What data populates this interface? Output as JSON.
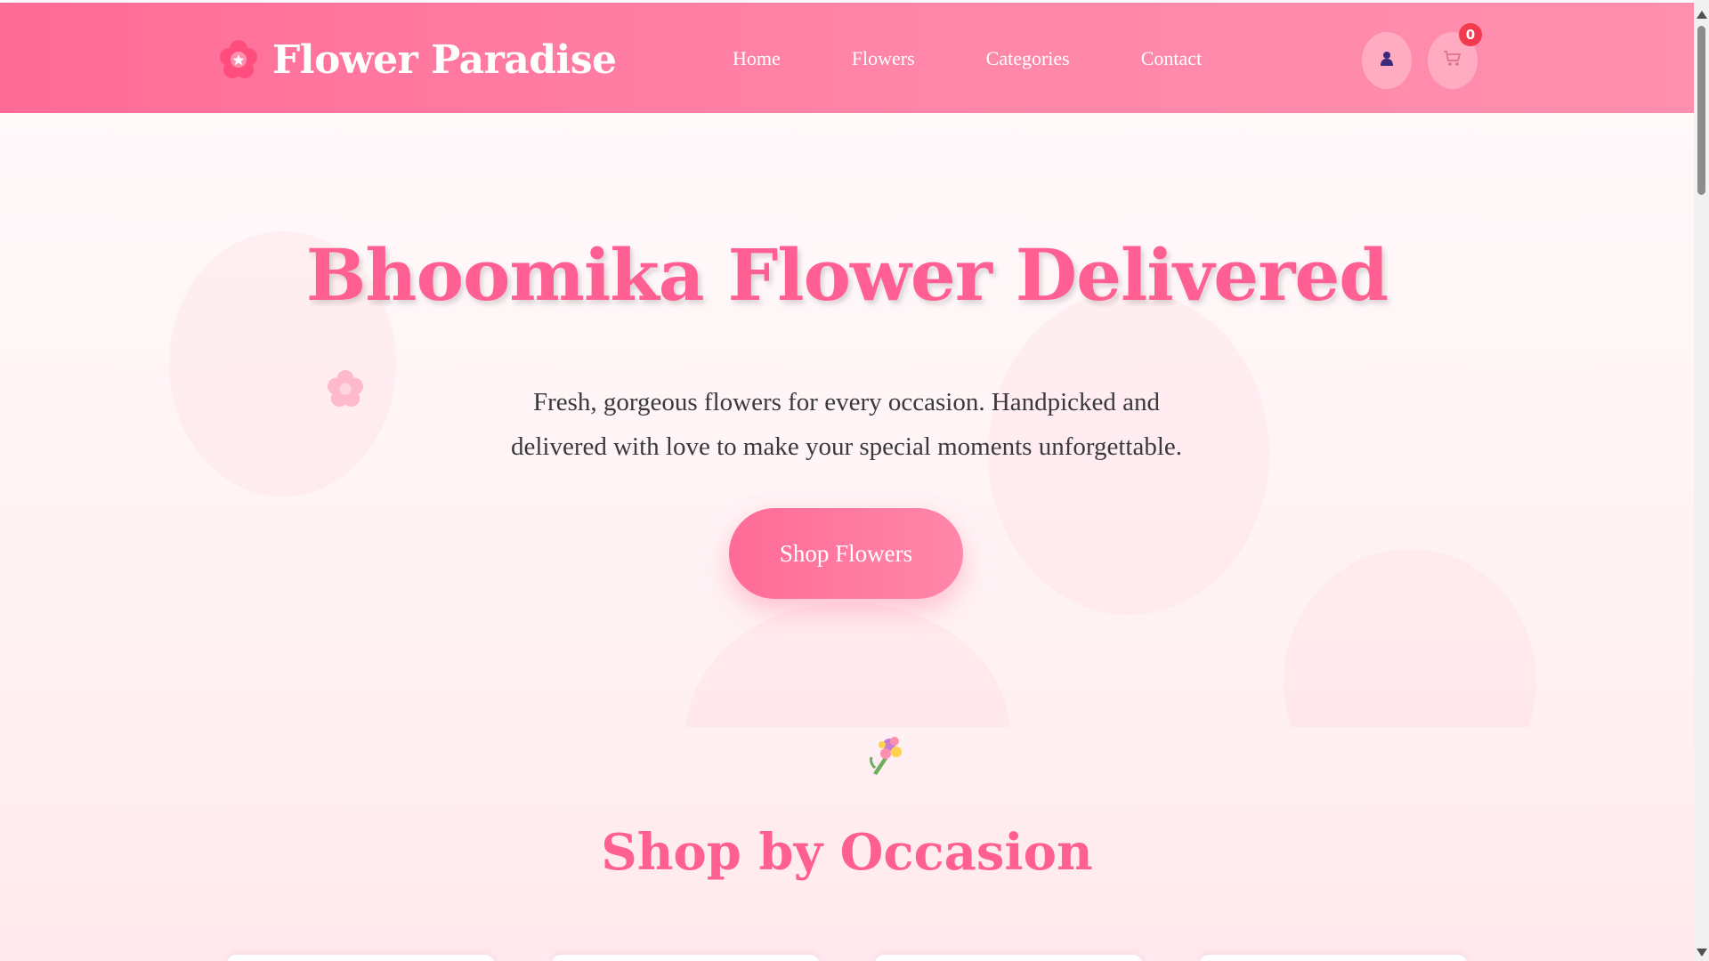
{
  "header": {
    "brand": "Flower Paradise",
    "logo_icon": "flower-icon",
    "nav": [
      "Home",
      "Flowers",
      "Categories",
      "Contact"
    ],
    "user_icon": "user-icon",
    "cart_icon": "cart-icon",
    "cart_count": "0"
  },
  "hero": {
    "title": "Bhoomika Flower Delivered",
    "subtitle": "Fresh, gorgeous flowers for every occasion. Handpicked and delivered with love to make your special moments unforgettable.",
    "cta_label": "Shop Flowers",
    "decor_icon": "flower-icon"
  },
  "occasion": {
    "icon": "bouquet-icon",
    "title": "Shop by Occasion"
  },
  "colors": {
    "brand_pink": "#ff6b97",
    "title_pink": "#ff5f92",
    "badge_red": "#f2394d"
  }
}
